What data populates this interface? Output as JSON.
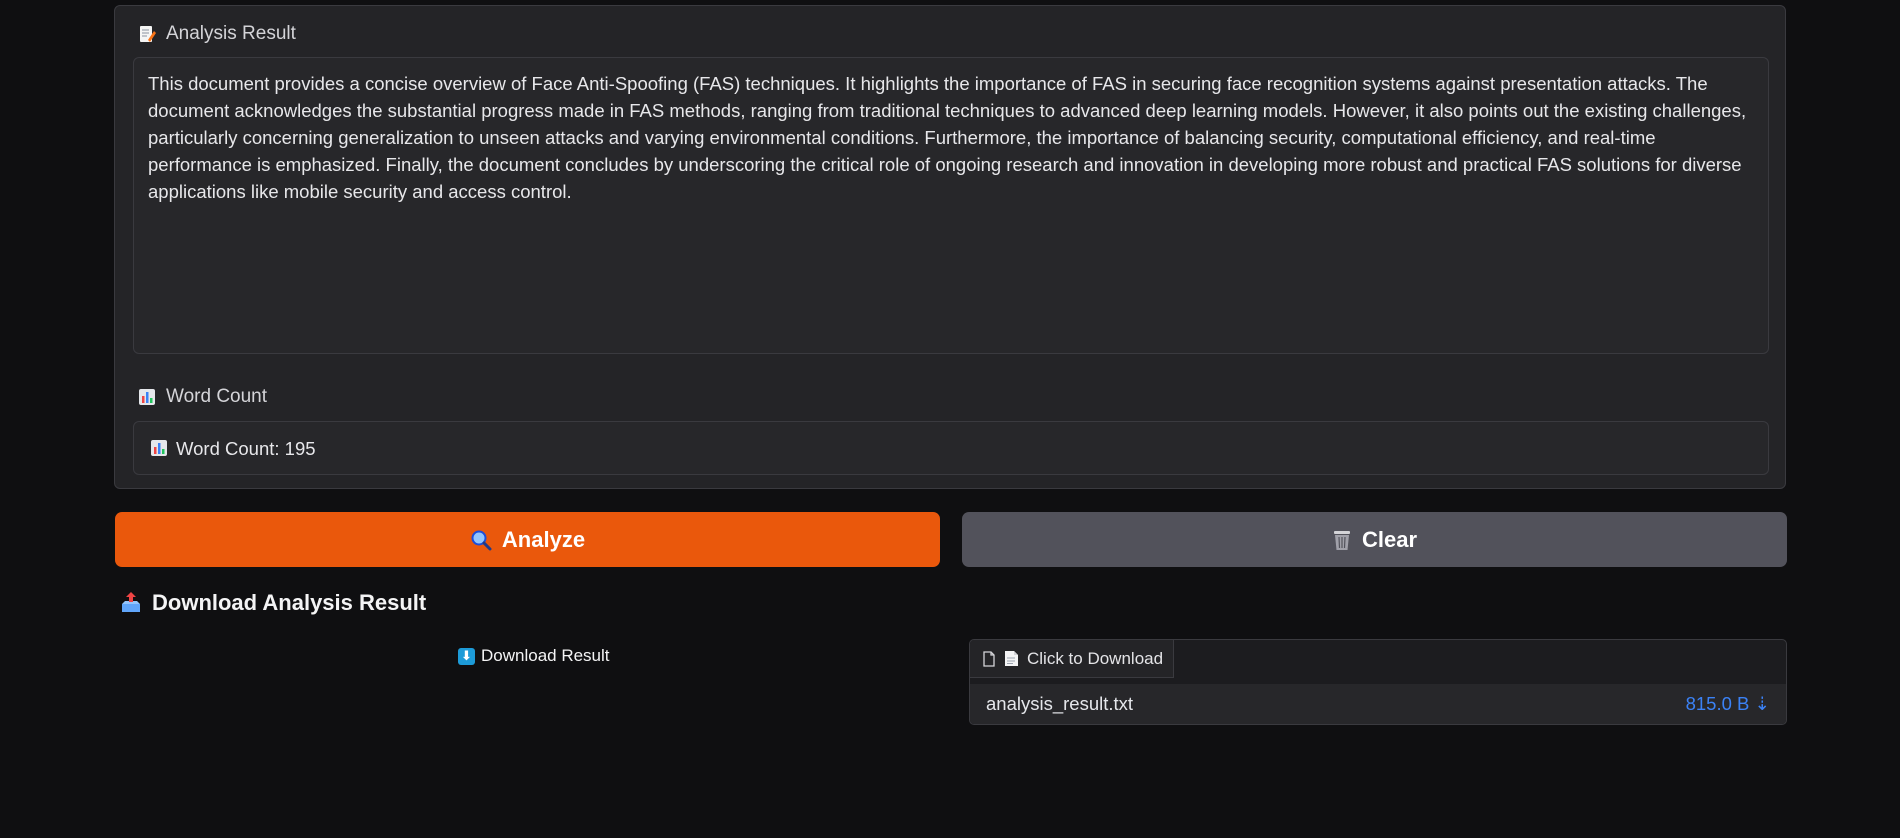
{
  "analysis": {
    "label": "Analysis Result",
    "label_icon": "memo-icon",
    "text": "This document provides a concise overview of Face Anti-Spoofing (FAS) techniques. It highlights the importance of FAS in securing face recognition systems against presentation attacks. The document acknowledges the substantial progress made in FAS methods, ranging from traditional techniques to advanced deep learning models. However, it also points out the existing challenges, particularly concerning generalization to unseen attacks and varying environmental conditions.  Furthermore, the importance of balancing security, computational efficiency, and real-time performance is emphasized. Finally, the document concludes by underscoring the critical role of ongoing research and innovation in developing more robust and practical FAS solutions for diverse applications like mobile security and access control."
  },
  "word_count": {
    "label": "Word Count",
    "label_icon": "bar-chart-icon",
    "value_text": "Word Count: 195"
  },
  "buttons": {
    "analyze": "Analyze",
    "analyze_icon": "magnifier-icon",
    "clear": "Clear",
    "clear_icon": "wastebasket-icon"
  },
  "download": {
    "section_title": "Download Analysis Result",
    "section_icon": "outbox-tray-icon",
    "link_label": "Download Result",
    "link_icon": "down-arrow-icon",
    "file_tab_label": "Click to Download",
    "file_name": "analysis_result.txt",
    "file_size": "815.0 B ⇣"
  },
  "colors": {
    "accent": "#ea580c",
    "secondary_button": "#52525b",
    "link": "#3b82f6",
    "background": "#0f0f11",
    "panel": "#242427"
  }
}
